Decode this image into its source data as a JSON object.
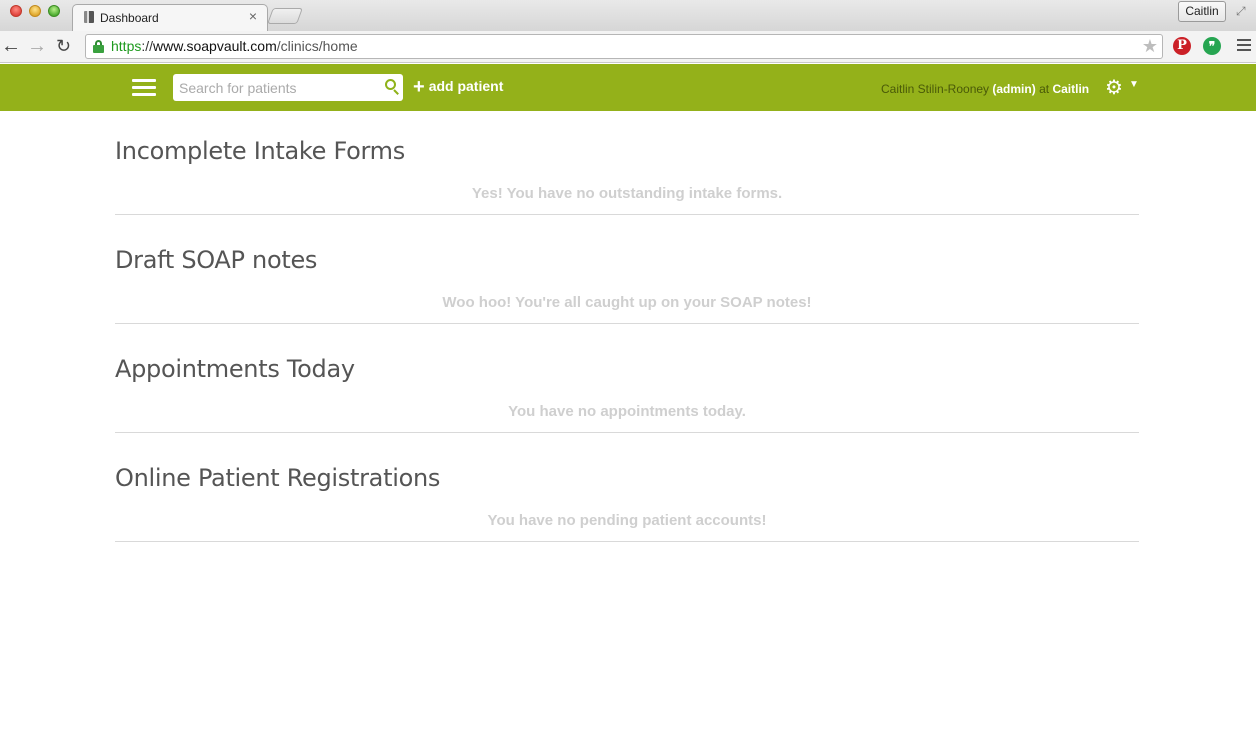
{
  "browser": {
    "tab_title": "Dashboard",
    "tab_close": "×",
    "profile_name": "Caitlin",
    "url": {
      "scheme": "https",
      "separator": "://",
      "host": "www.soapvault.com",
      "path": "/clinics/home"
    },
    "icons": {
      "back": "arrow-left",
      "forward": "arrow-right",
      "reload": "reload",
      "star": "bookmark-star",
      "pinterest": "pinterest-extension",
      "hangouts": "hangouts-extension",
      "menu": "chrome-menu"
    },
    "colors": {
      "secure_green": "#1e9a1e",
      "pinterest_red": "#cb2027",
      "hangouts_green": "#26a551"
    }
  },
  "header": {
    "search_placeholder": "Search for patients",
    "add_patient_label": "add patient",
    "user_name": "Caitlin Stilin-Rooney",
    "user_role": "(admin)",
    "at_text": "at",
    "clinic_name": "Caitlin",
    "colors": {
      "bar": "#94b11a",
      "muted_text": "#4a5a08"
    }
  },
  "sections": [
    {
      "title": "Incomplete Intake Forms",
      "empty_message": "Yes! You have no outstanding intake forms."
    },
    {
      "title": "Draft SOAP notes",
      "empty_message": "Woo hoo! You're all caught up on your SOAP notes!"
    },
    {
      "title": "Appointments Today",
      "empty_message": "You have no appointments today."
    },
    {
      "title": "Online Patient Registrations",
      "empty_message": "You have no pending patient accounts!"
    }
  ]
}
